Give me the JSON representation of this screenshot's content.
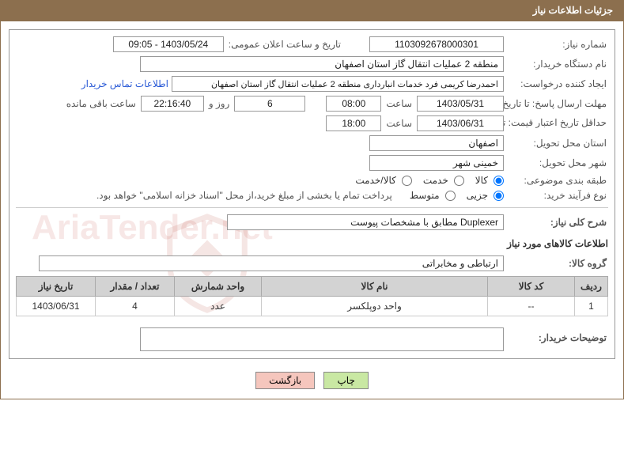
{
  "header": {
    "title": "جزئیات اطلاعات نیاز"
  },
  "labels": {
    "need_no": "شماره نیاز:",
    "announce": "تاریخ و ساعت اعلان عمومی:",
    "buyer_org": "نام دستگاه خریدار:",
    "requester": "ایجاد کننده درخواست:",
    "contact_link": "اطلاعات تماس خریدار",
    "deadline_answer": "مهلت ارسال پاسخ: تا تاریخ:",
    "time_word": "ساعت",
    "days_and": "روز و",
    "time_remaining": "ساعت باقی مانده",
    "min_validity": "حداقل تاریخ اعتبار قیمت: تا تاریخ:",
    "delivery_province": "استان محل تحویل:",
    "delivery_city": "شهر محل تحویل:",
    "category": "طبقه بندی موضوعی:",
    "purchase_type": "نوع فرآیند خرید:",
    "payment_note": "پرداخت تمام یا بخشی از مبلغ خرید،از محل \"اسناد خزانه اسلامی\" خواهد بود.",
    "general_desc": "شرح کلی نیاز:",
    "items_info": "اطلاعات کالاهای مورد نیاز",
    "item_group": "گروه کالا:",
    "buyer_notes": "توضیحات خریدار:"
  },
  "values": {
    "need_no": "1103092678000301",
    "announce": "1403/05/24 - 09:05",
    "buyer_org": "منطقه 2 عملیات انتقال گاز استان اصفهان",
    "requester": "احمدرضا کریمی فرد خدمات انبارداری منطقه 2 عملیات انتقال گاز استان اصفهان",
    "deadline_date": "1403/05/31",
    "deadline_time": "08:00",
    "days_remaining": "6",
    "countdown": "22:16:40",
    "validity_date": "1403/06/31",
    "validity_time": "18:00",
    "province": "اصفهان",
    "city": "خمینی شهر",
    "general_desc": "Duplexer مطابق با مشخصات پیوست",
    "item_group": "ارتباطی و مخابراتی",
    "buyer_notes": ""
  },
  "radios": {
    "category": {
      "options": [
        "کالا",
        "خدمت",
        "کالا/خدمت"
      ],
      "selected": 0
    },
    "purchase_type": {
      "options": [
        "جزیی",
        "متوسط"
      ],
      "selected": 0
    }
  },
  "table": {
    "headers": [
      "ردیف",
      "کد کالا",
      "نام کالا",
      "واحد شمارش",
      "تعداد / مقدار",
      "تاریخ نیاز"
    ],
    "rows": [
      {
        "index": "1",
        "code": "--",
        "name": "واحد دوپلکسر",
        "unit": "عدد",
        "qty": "4",
        "date": "1403/06/31"
      }
    ]
  },
  "buttons": {
    "print": "چاپ",
    "back": "بازگشت"
  },
  "watermark": "AriaTender.net"
}
